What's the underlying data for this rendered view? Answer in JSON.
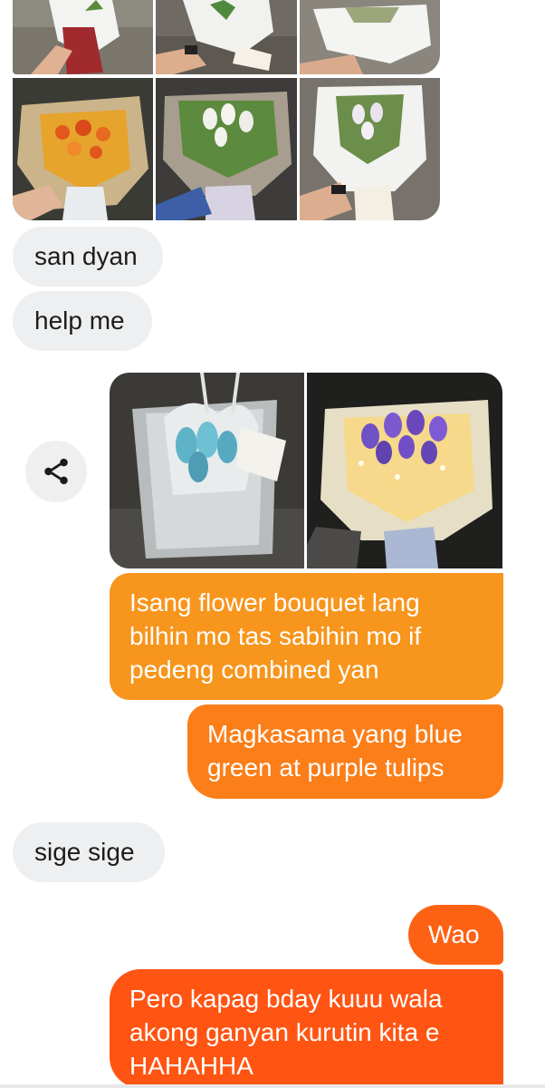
{
  "thread": {
    "received_photos": {
      "alt": [
        "bouquet",
        "bouquet",
        "bouquet",
        "bouquet",
        "bouquet",
        "bouquet"
      ]
    },
    "messages": [
      {
        "id": "m1",
        "direction": "incoming",
        "text": "san dyan"
      },
      {
        "id": "m2",
        "direction": "incoming",
        "text": "help me"
      },
      {
        "id": "m3",
        "direction": "outgoing",
        "text": "Isang flower bouquet lang bilhin mo tas sabihin mo if pedeng combined yan"
      },
      {
        "id": "m4",
        "direction": "outgoing",
        "text": "Magkasama yang blue green at purple tulips"
      },
      {
        "id": "m5",
        "direction": "incoming",
        "text": "sige sige"
      },
      {
        "id": "m6",
        "direction": "outgoing",
        "text": "Wao"
      },
      {
        "id": "m7",
        "direction": "outgoing",
        "text": "Pero kapag bday kuuu wala akong ganyan kurutin kita e HAHAHHA"
      }
    ],
    "share_button": {
      "icon": "share-icon"
    }
  },
  "colors": {
    "incoming_bubble": "#eeeff0",
    "outgoing_gradient_top": "#f7a21c",
    "outgoing_gradient_bottom": "#ff5412"
  }
}
